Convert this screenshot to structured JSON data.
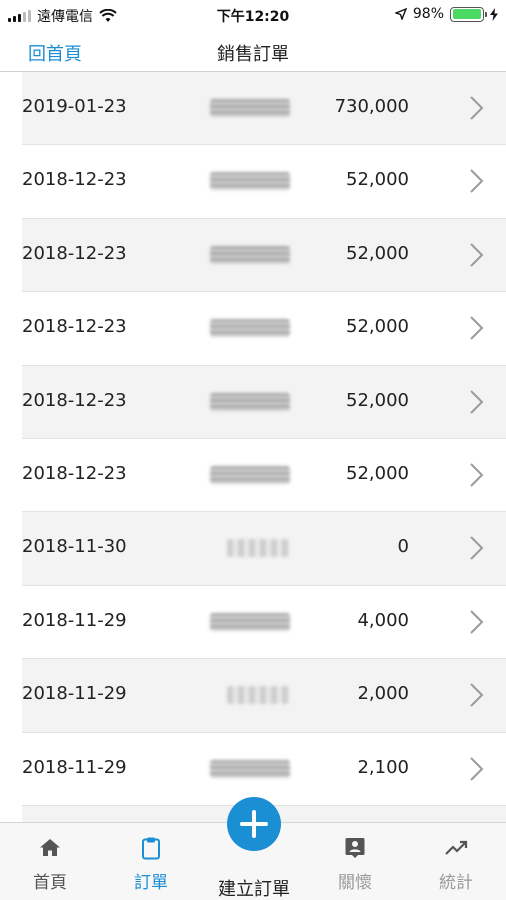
{
  "status_bar": {
    "carrier": "遠傳電信",
    "time": "下午12:20",
    "battery": "98%",
    "battery_level": 0.98
  },
  "nav": {
    "back_label": "回首頁",
    "title": "銷售訂單"
  },
  "orders": [
    {
      "date": "2019-01-23",
      "amount": "730,000"
    },
    {
      "date": "2018-12-23",
      "amount": "52,000"
    },
    {
      "date": "2018-12-23",
      "amount": "52,000"
    },
    {
      "date": "2018-12-23",
      "amount": "52,000"
    },
    {
      "date": "2018-12-23",
      "amount": "52,000"
    },
    {
      "date": "2018-12-23",
      "amount": "52,000"
    },
    {
      "date": "2018-11-30",
      "amount": "0"
    },
    {
      "date": "2018-11-29",
      "amount": "4,000"
    },
    {
      "date": "2018-11-29",
      "amount": "2,000"
    },
    {
      "date": "2018-11-29",
      "amount": "2,100"
    }
  ],
  "tabs": {
    "home": "首頁",
    "orders": "訂單",
    "create": "建立訂單",
    "care": "關懷",
    "stats": "統計"
  },
  "colors": {
    "accent": "#1a8fd4",
    "row_alt": "#f3f3f3",
    "battery": "#4cd964"
  },
  "icons": {
    "home": "home-icon",
    "orders": "clipboard-icon",
    "create": "plus-icon",
    "care": "contact-icon",
    "stats": "trending-up-icon",
    "row": "chevron-right-icon"
  }
}
